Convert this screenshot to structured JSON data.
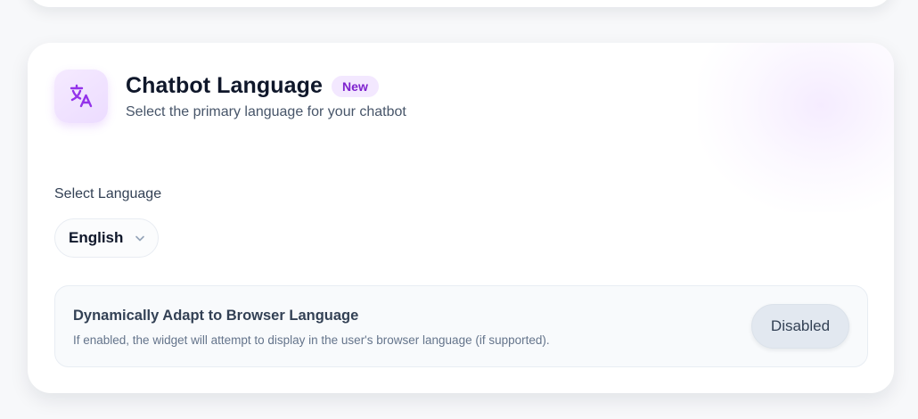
{
  "section": {
    "icon": "translate-icon",
    "title": "Chatbot Language",
    "badge": "New",
    "subtitle": "Select the primary language for your chatbot"
  },
  "language_select": {
    "label": "Select Language",
    "value": "English",
    "icon": "chevron-down-icon"
  },
  "browser_adapt": {
    "title": "Dynamically Adapt to Browser Language",
    "description": "If enabled, the widget will attempt to display in the user's browser language (if supported).",
    "toggle_label": "Disabled"
  },
  "colors": {
    "accent": "#9333ea",
    "badge_bg": "#f3e8ff",
    "badge_text": "#7e22ce",
    "toggle_bg": "#e2e8f0"
  }
}
